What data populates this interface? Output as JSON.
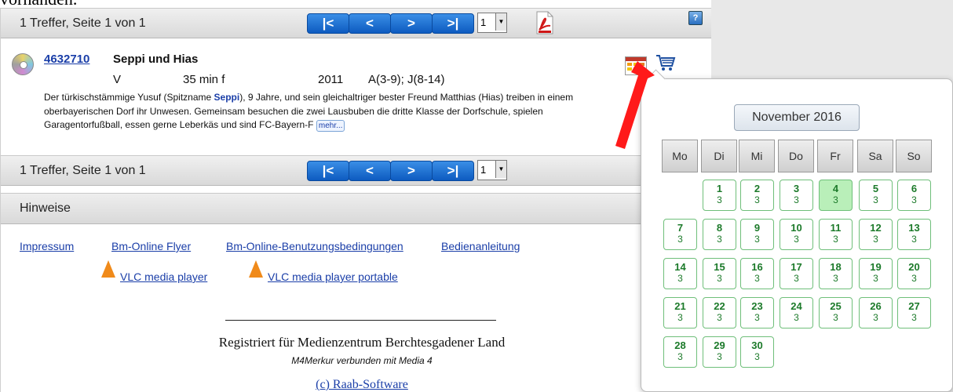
{
  "top_fragment": "vorhanden.",
  "pager_top": {
    "text": "1 Treffer, Seite 1 von 1",
    "page_value": "1"
  },
  "pager_bottom": {
    "text": "1 Treffer, Seite 1 von 1",
    "page_value": "1"
  },
  "nav": {
    "first": "|<",
    "prev": "<",
    "next": ">",
    "last": ">|"
  },
  "help_label": "?",
  "record": {
    "id": "4632710",
    "title": "Seppi und Hias",
    "type": "V",
    "duration": "35 min f",
    "year": "2011",
    "age": "A(3-9); J(8-14)",
    "desc_before": "Der türkischstämmige Yusuf (Spitzname ",
    "desc_highlight": "Seppi",
    "desc_after": "), 9 Jahre, und sein gleichaltriger bester Freund Matthias (Hias) treiben in einem oberbayerischen Dorf ihr Unwesen. Gemeinsam besuchen die zwei Lausbuben die dritte Klasse der Dorfschule, spielen Garagentorfußball, essen gerne Leberkäs und sind FC-Bayern-F ",
    "more_label": "mehr..."
  },
  "section_title": "Hinweise",
  "links": {
    "impressum": "Impressum",
    "flyer": "Bm-Online Flyer",
    "terms": "Bm-Online-Benutzungsbedingungen",
    "manual": "Bedienanleitung",
    "vlc": "VLC media player",
    "vlc_portable": "VLC media player portable"
  },
  "footer": {
    "registered": "Registriert für Medienzentrum Berchtesgadener Land",
    "merkur": "M4Merkur verbunden mit Media 4",
    "copyright": "(c) Raab-Software"
  },
  "calendar": {
    "month": "November 2016",
    "weekdays": [
      "Mo",
      "Di",
      "Mi",
      "Do",
      "Fr",
      "Sa",
      "So"
    ],
    "start_weekday_index": 1,
    "today": "4",
    "days": [
      {
        "d": "1",
        "c": "3"
      },
      {
        "d": "2",
        "c": "3"
      },
      {
        "d": "3",
        "c": "3"
      },
      {
        "d": "4",
        "c": "3"
      },
      {
        "d": "5",
        "c": "3"
      },
      {
        "d": "6",
        "c": "3"
      },
      {
        "d": "7",
        "c": "3"
      },
      {
        "d": "8",
        "c": "3"
      },
      {
        "d": "9",
        "c": "3"
      },
      {
        "d": "10",
        "c": "3"
      },
      {
        "d": "11",
        "c": "3"
      },
      {
        "d": "12",
        "c": "3"
      },
      {
        "d": "13",
        "c": "3"
      },
      {
        "d": "14",
        "c": "3"
      },
      {
        "d": "15",
        "c": "3"
      },
      {
        "d": "16",
        "c": "3"
      },
      {
        "d": "17",
        "c": "3"
      },
      {
        "d": "18",
        "c": "3"
      },
      {
        "d": "19",
        "c": "3"
      },
      {
        "d": "20",
        "c": "3"
      },
      {
        "d": "21",
        "c": "3"
      },
      {
        "d": "22",
        "c": "3"
      },
      {
        "d": "23",
        "c": "3"
      },
      {
        "d": "24",
        "c": "3"
      },
      {
        "d": "25",
        "c": "3"
      },
      {
        "d": "26",
        "c": "3"
      },
      {
        "d": "27",
        "c": "3"
      },
      {
        "d": "28",
        "c": "3"
      },
      {
        "d": "29",
        "c": "3"
      },
      {
        "d": "30",
        "c": "3"
      }
    ]
  },
  "icons": {
    "disc": "cd-icon",
    "pdf": "pdf-icon",
    "calendar": "calendar-icon",
    "cart": "cart-icon",
    "vlc": "vlc-cone-icon",
    "arrow": "red-arrow-icon"
  },
  "colors": {
    "link": "#1a3ea8",
    "nav_button": "#0d5bc0",
    "day_border": "#6fbf7a",
    "today_bg": "#b9efb9",
    "arrow": "#ff1a1a"
  }
}
